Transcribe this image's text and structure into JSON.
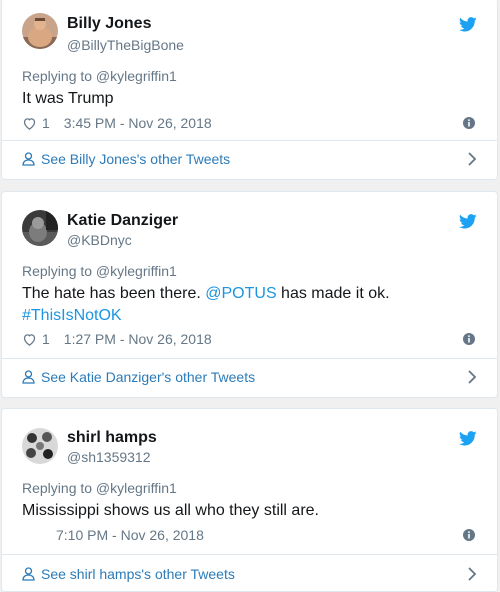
{
  "tweets": [
    {
      "name": "Billy Jones",
      "handle": "@BillyTheBigBone",
      "replying_to": "Replying to @kylegriffin1",
      "text": "It was Trump",
      "likes": "1",
      "timestamp": "3:45 PM - Nov 26, 2018",
      "footer": "See Billy Jones's other Tweets"
    },
    {
      "name": "Katie Danziger",
      "handle": "@KBDnyc",
      "replying_to": "Replying to @kylegriffin1",
      "text_part1": "The hate has been there. ",
      "text_mention": "@POTUS",
      "text_part2": " has made it ok.",
      "text_hashtag": "#ThisIsNotOK",
      "likes": "1",
      "timestamp": "1:27 PM - Nov 26, 2018",
      "footer": "See Katie Danziger's other Tweets"
    },
    {
      "name": "shirl hamps",
      "handle": "@sh1359312",
      "replying_to": "Replying to @kylegriffin1",
      "text": "Mississippi shows us all who they still are.",
      "timestamp": "7:10 PM - Nov 26, 2018",
      "footer": "See shirl hamps's other Tweets"
    }
  ],
  "icons": {
    "heart": "heart-icon",
    "info": "info-icon",
    "bird": "twitter-bird-icon",
    "person": "person-icon",
    "chevron": "chevron-right-icon"
  },
  "colors": {
    "text": "#14171a",
    "muted": "#657786",
    "link": "#1b95e0",
    "footer_link": "#2b7bb9",
    "border": "#e1e8ed"
  }
}
